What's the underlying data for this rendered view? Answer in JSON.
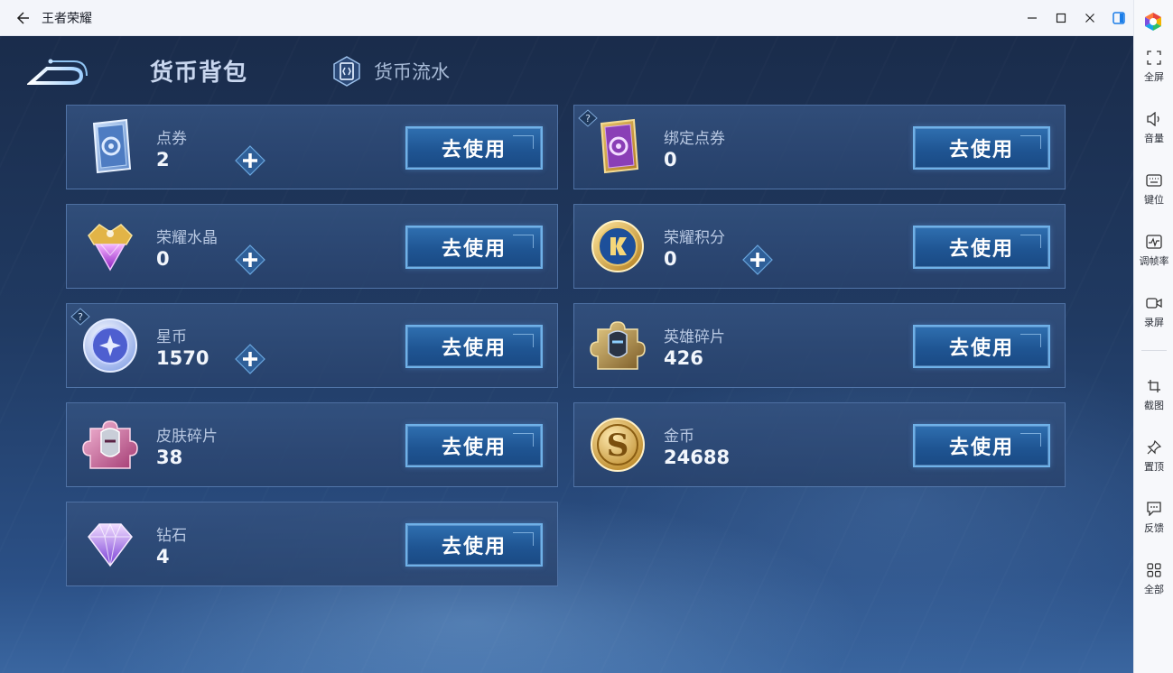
{
  "window": {
    "title": "王者荣耀"
  },
  "sidebar": {
    "items": [
      {
        "label": "全屏",
        "icon": "fullscreen-icon"
      },
      {
        "label": "音量",
        "icon": "volume-icon"
      },
      {
        "label": "键位",
        "icon": "keyboard-icon"
      },
      {
        "label": "调帧率",
        "icon": "frame-rate-icon"
      },
      {
        "label": "录屏",
        "icon": "record-icon"
      },
      {
        "label": "截图",
        "icon": "crop-icon"
      },
      {
        "label": "置顶",
        "icon": "pin-icon"
      },
      {
        "label": "反馈",
        "icon": "feedback-icon"
      },
      {
        "label": "全部",
        "icon": "grid-icon"
      }
    ]
  },
  "header": {
    "active_tab": "货币背包",
    "inactive_tab": "货币流水"
  },
  "currencies": [
    {
      "name": "点券",
      "amount": "2",
      "button": "去使用",
      "icon": "coupon-blue-icon"
    },
    {
      "name": "绑定点券",
      "amount": "0",
      "button": "去使用",
      "icon": "coupon-purple-icon"
    },
    {
      "name": "荣耀水晶",
      "amount": "0",
      "button": "去使用",
      "icon": "glory-crystal-icon"
    },
    {
      "name": "荣耀积分",
      "amount": "0",
      "button": "去使用",
      "icon": "glory-points-icon"
    },
    {
      "name": "星币",
      "amount": "1570",
      "button": "去使用",
      "icon": "star-coin-icon"
    },
    {
      "name": "英雄碎片",
      "amount": "426",
      "button": "去使用",
      "icon": "hero-fragment-icon"
    },
    {
      "name": "皮肤碎片",
      "amount": "38",
      "button": "去使用",
      "icon": "skin-fragment-icon"
    },
    {
      "name": "金币",
      "amount": "24688",
      "button": "去使用",
      "icon": "gold-coin-icon"
    },
    {
      "name": "钻石",
      "amount": "4",
      "button": "去使用",
      "icon": "diamond-icon"
    }
  ]
}
